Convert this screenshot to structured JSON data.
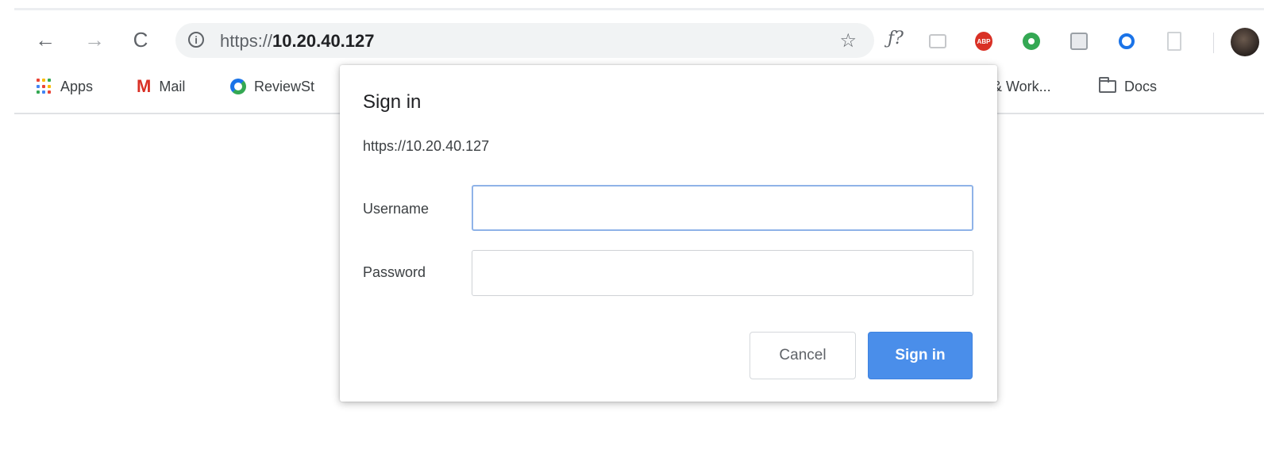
{
  "toolbar": {
    "back_icon": "←",
    "forward_icon": "→",
    "reload_icon": "C",
    "info_icon": "i",
    "url_scheme": "https://",
    "url_host": "10.20.40.127",
    "star_icon": "☆",
    "script_ext": "ƒ?",
    "adblock_ext": "ABP",
    "icons": [
      "back-arrow-icon",
      "forward-arrow-icon",
      "reload-icon",
      "info-icon",
      "star-icon",
      "script-extension-icon",
      "camera-extension-icon",
      "adblock-extension-icon",
      "green-extension-icon",
      "gray-extension-icon",
      "blue-ring-extension-icon",
      "document-extension-icon",
      "profile-avatar"
    ]
  },
  "bookmarks": {
    "apps": "Apps",
    "mail": "Mail",
    "review": "ReviewSt",
    "work": "& Work...",
    "docs": "Docs",
    "apps_colors": [
      "#ea4335",
      "#fbbc05",
      "#34a853",
      "#4285f4",
      "#ea4335",
      "#fbbc05",
      "#34a853",
      "#4285f4",
      "#ea4335"
    ]
  },
  "dialog": {
    "title": "Sign in",
    "origin": "https://10.20.40.127",
    "username_label": "Username",
    "username_value": "",
    "password_label": "Password",
    "password_value": "",
    "cancel_label": "Cancel",
    "signin_label": "Sign in"
  },
  "colors": {
    "primary_button": "#4a8eea",
    "focus_border": "#8fb3e8"
  }
}
